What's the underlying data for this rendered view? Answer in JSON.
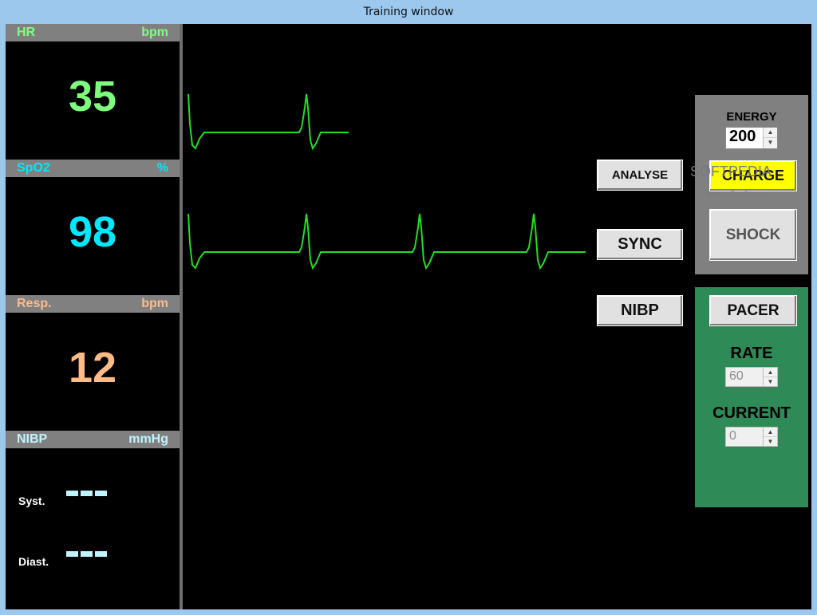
{
  "window": {
    "title": "Training window"
  },
  "vitals": {
    "hr": {
      "label": "HR",
      "unit": "bpm",
      "value": "35",
      "color": "#7dff7d"
    },
    "spo2": {
      "label": "SpO2",
      "unit": "%",
      "value": "98",
      "color": "#00e8ff"
    },
    "resp": {
      "label": "Resp.",
      "unit": "bpm",
      "value": "12",
      "color": "#ffbb88"
    },
    "nibp": {
      "label": "NIBP",
      "unit": "mmHg",
      "systolic_label": "Syst.",
      "diastolic_label": "Diast.",
      "color": "#bff4ff"
    }
  },
  "waveform": {
    "color": "#22dd22"
  },
  "buttons": {
    "analyse": "ANALYSE",
    "sync": "SYNC",
    "nibp": "NIBP"
  },
  "defib": {
    "energy_label": "ENERGY",
    "energy_value": "200",
    "charge_label": "CHARGE",
    "charge_color": "#ffff00",
    "shock_label": "SHOCK"
  },
  "pacer": {
    "pacer_label": "PACER",
    "rate_label": "RATE",
    "rate_value": "60",
    "current_label": "CURRENT",
    "current_value": "0"
  },
  "watermark": {
    "text": "SOFTPEDIA",
    "sub": "www.softpedia.com"
  }
}
